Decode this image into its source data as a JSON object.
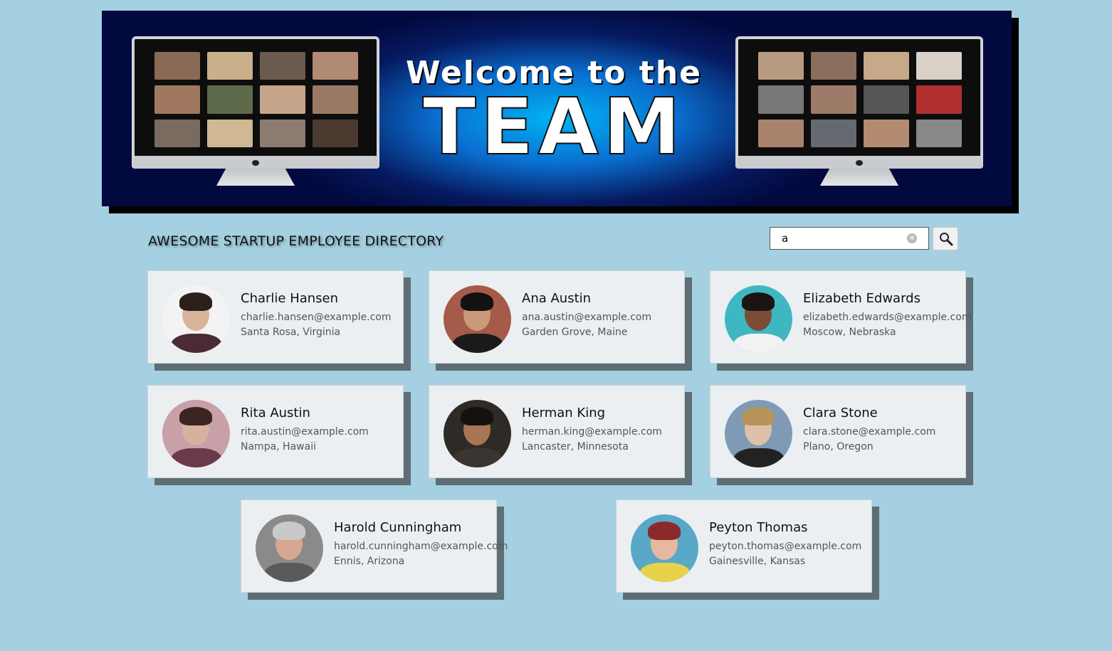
{
  "banner": {
    "title_line1": "Welcome to the",
    "title_line2": "TEAM"
  },
  "header": {
    "title": "AWESOME STARTUP EMPLOYEE DIRECTORY"
  },
  "search": {
    "value": "a",
    "clear_icon": "clear-circle-icon",
    "button_icon": "search-icon"
  },
  "colors": {
    "page_background": "#a4d0e1",
    "card_background": "#ebeff2",
    "card_shadow": "#5f6d75",
    "banner_dark": "#02093e",
    "banner_glow": "#00b4f5"
  },
  "employees": [
    {
      "name": "Charlie Hansen",
      "email": "charlie.hansen@example.com",
      "location": "Santa Rosa, Virginia"
    },
    {
      "name": "Ana Austin",
      "email": "ana.austin@example.com",
      "location": "Garden Grove, Maine"
    },
    {
      "name": "Elizabeth Edwards",
      "email": "elizabeth.edwards@example.com",
      "location": "Moscow, Nebraska"
    },
    {
      "name": "Rita Austin",
      "email": "rita.austin@example.com",
      "location": "Nampa, Hawaii"
    },
    {
      "name": "Herman King",
      "email": "herman.king@example.com",
      "location": "Lancaster, Minnesota"
    },
    {
      "name": "Clara Stone",
      "email": "clara.stone@example.com",
      "location": "Plano, Oregon"
    },
    {
      "name": "Harold Cunningham",
      "email": "harold.cunningham@example.com",
      "location": "Ennis, Arizona"
    },
    {
      "name": "Peyton Thomas",
      "email": "peyton.thomas@example.com",
      "location": "Gainesville, Kansas"
    }
  ]
}
